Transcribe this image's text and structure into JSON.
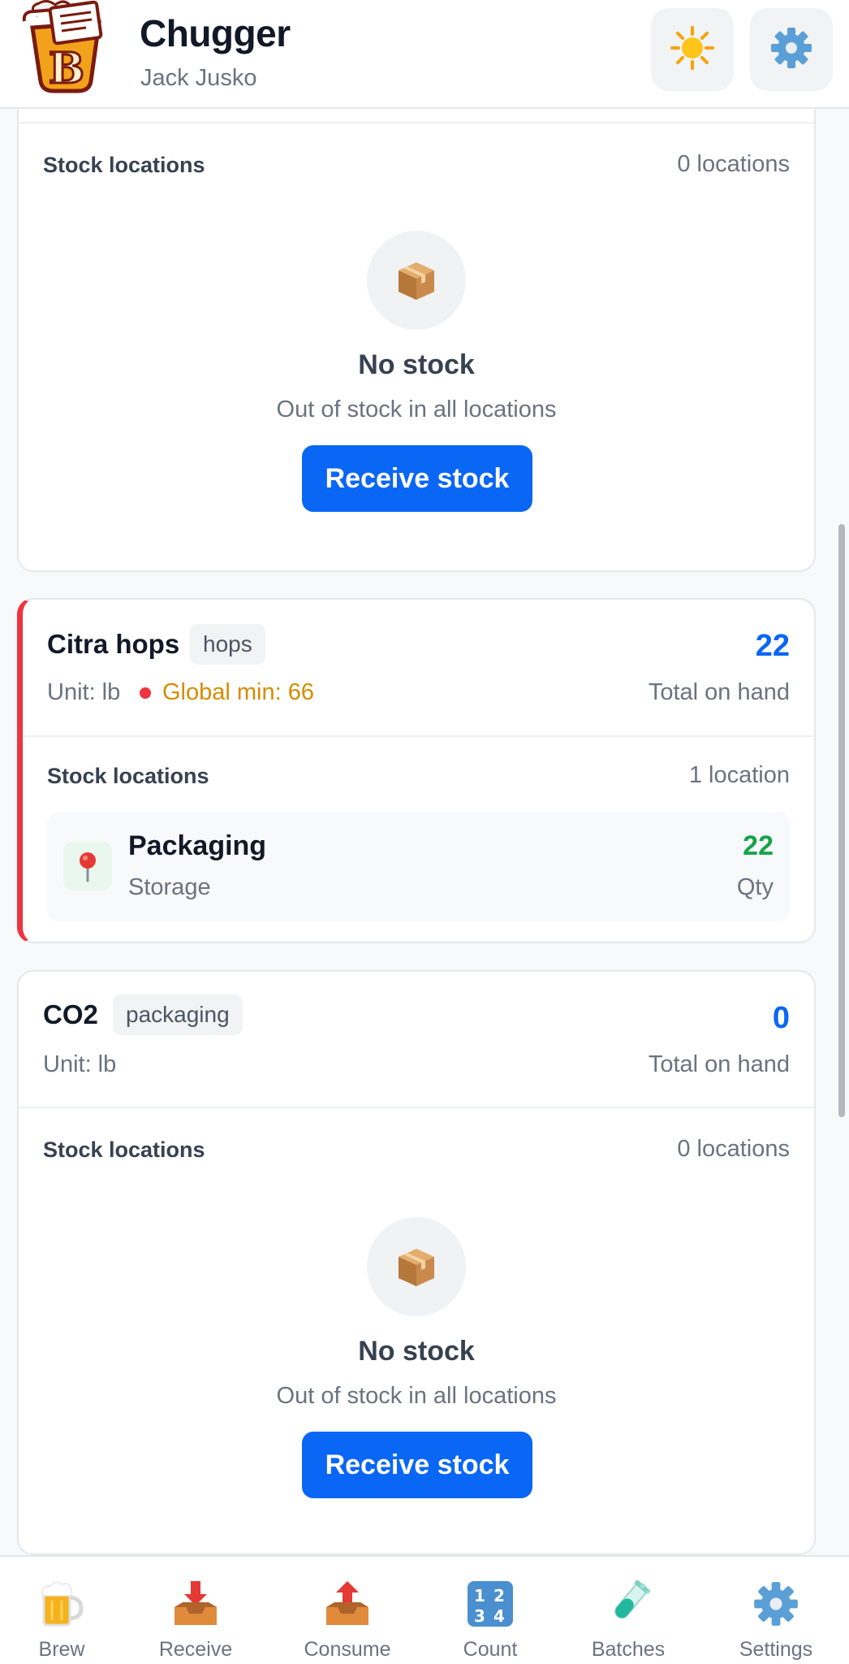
{
  "header": {
    "title": "Chugger",
    "user": "Jack Jusko",
    "theme_icon": "sun-icon",
    "settings_icon": "gear-icon"
  },
  "cards": [
    {
      "stock_label": "Stock locations",
      "location_count": "0 locations",
      "empty_title": "No stock",
      "empty_subtitle": "Out of stock in all locations",
      "receive_label": "Receive stock"
    },
    {
      "name": "Citra hops",
      "tag": "hops",
      "unit": "Unit: lb",
      "global_min": "Global min: 66",
      "total": "22",
      "total_label": "Total on hand",
      "stock_label": "Stock locations",
      "location_count": "1 location",
      "locations": [
        {
          "name": "Packaging",
          "type": "Storage",
          "qty": "22",
          "qty_label": "Qty"
        }
      ]
    },
    {
      "name": "CO2",
      "tag": "packaging",
      "unit": "Unit: lb",
      "total": "0",
      "total_label": "Total on hand",
      "stock_label": "Stock locations",
      "location_count": "0 locations",
      "empty_title": "No stock",
      "empty_subtitle": "Out of stock in all locations",
      "receive_label": "Receive stock"
    }
  ],
  "nav": [
    {
      "label": "Brew",
      "icon": "beer-mug-icon"
    },
    {
      "label": "Receive",
      "icon": "inbox-tray-icon"
    },
    {
      "label": "Consume",
      "icon": "outbox-tray-icon"
    },
    {
      "label": "Count",
      "icon": "numbers-icon"
    },
    {
      "label": "Batches",
      "icon": "test-tube-icon"
    },
    {
      "label": "Settings",
      "icon": "gear-icon"
    }
  ],
  "colors": {
    "accent": "#0a66f5",
    "low_stock_border": "#ef3340",
    "warning_text": "#d98a00",
    "qty_green": "#16a34a"
  }
}
